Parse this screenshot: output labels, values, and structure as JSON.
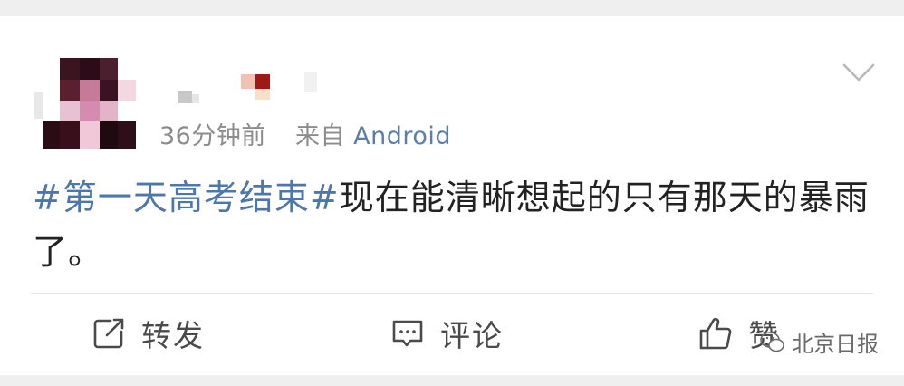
{
  "post": {
    "time": "36分钟前",
    "source_prefix": "来自",
    "source": "Android",
    "topic": "#第一天高考结束#",
    "text": "现在能清晰想起的只有那天的暴雨了。"
  },
  "actions": {
    "repost": "转发",
    "comment": "评论",
    "like": "赞"
  },
  "watermark": "北京日报",
  "icons": [
    "chevron-down-icon",
    "repost-icon",
    "comment-icon",
    "like-icon",
    "wechat-logo-icon"
  ],
  "colors": {
    "link": "#4c77ac",
    "meta": "#8c8c8c",
    "source": "#5b7fa8"
  }
}
